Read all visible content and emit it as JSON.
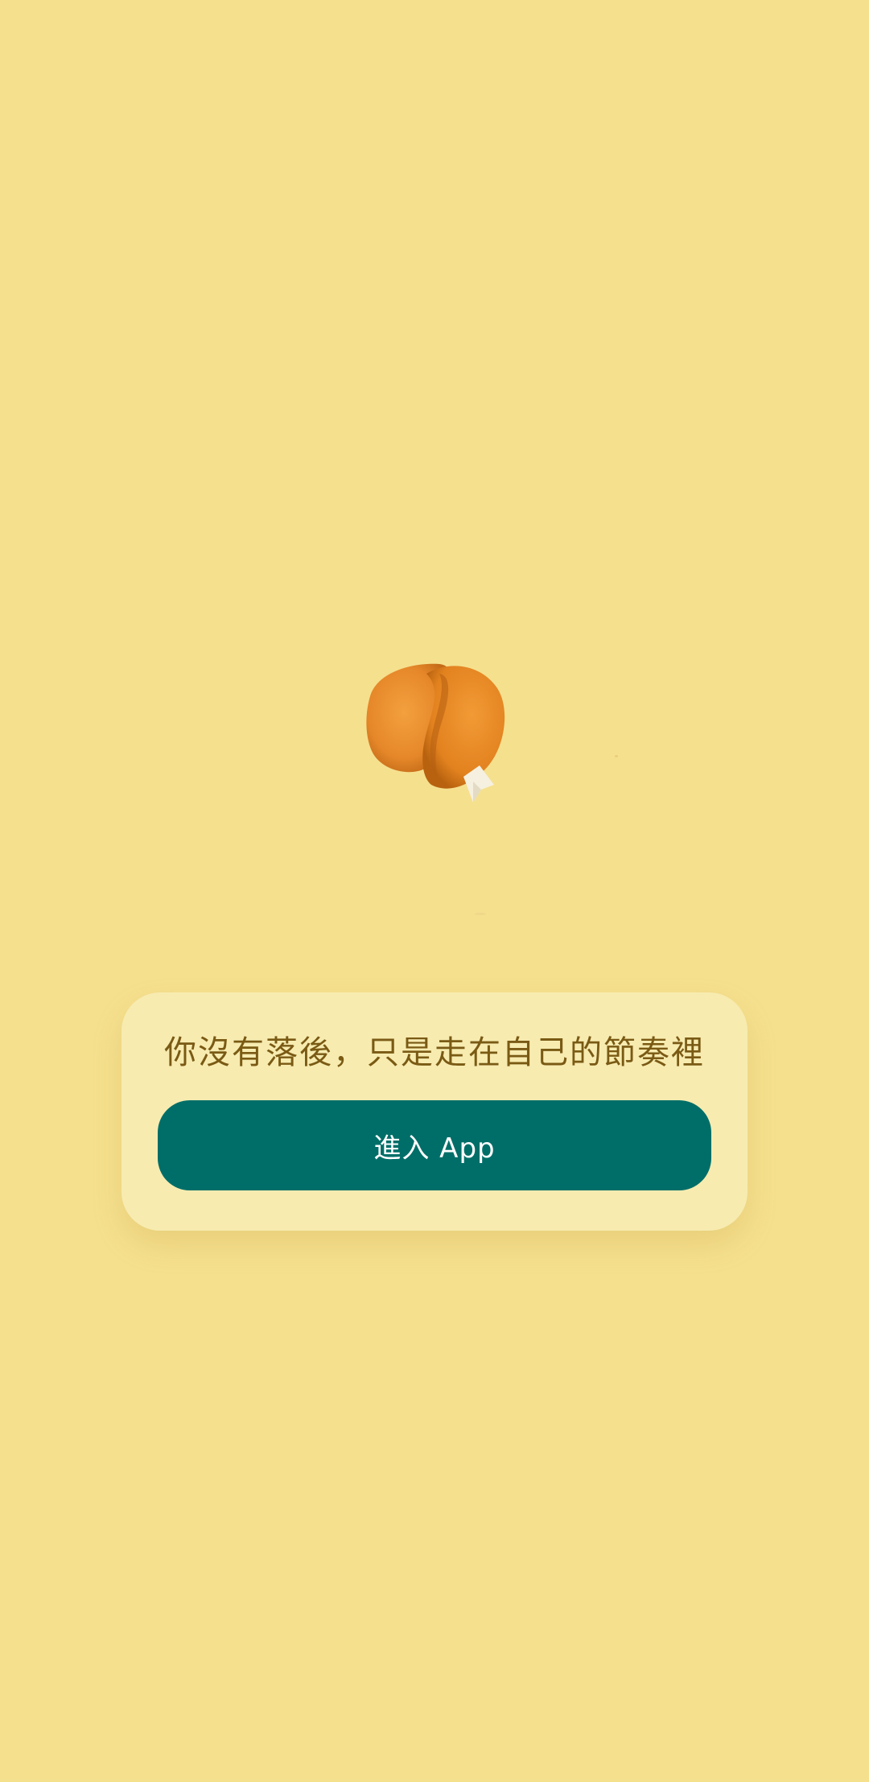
{
  "splash": {
    "image": "fortune-cookie-icon",
    "fortune_text": "你沒有落後，只是走在自己的節奏裡",
    "enter_button_label": "進入 App"
  },
  "colors": {
    "background": "#f5e08e",
    "card": "#f7ebb0",
    "fortune_text": "#7a5a14",
    "button": "#006e68",
    "button_text": "#ffffff"
  }
}
